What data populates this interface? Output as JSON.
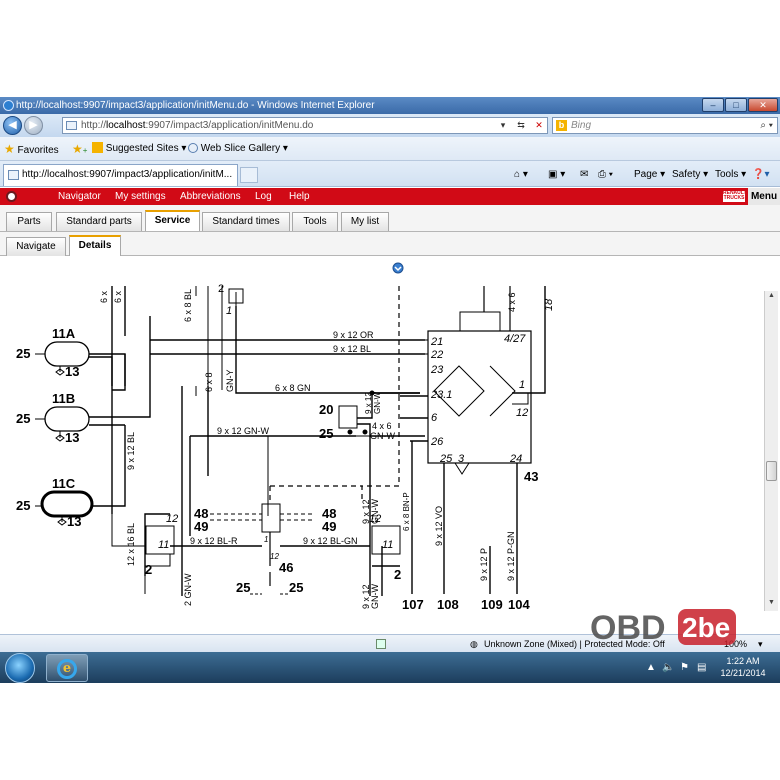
{
  "window": {
    "title": "http://localhost:9907/impact3/application/initMenu.do - Windows Internet Explorer"
  },
  "address": {
    "prefix": "http://",
    "host": "localhost",
    "rest": ":9907/impact3/application/initMenu.do",
    "search_placeholder": "Bing"
  },
  "favorites": {
    "label": "Favorites",
    "suggested": "Suggested Sites ▾",
    "webslice": "Web Slice Gallery ▾"
  },
  "ie_tab": {
    "label": "http://localhost:9907/impact3/application/initM..."
  },
  "commandbar": {
    "page": "Page ▾",
    "safety": "Safety ▾",
    "tools": "Tools ▾"
  },
  "app_menu": {
    "items": [
      "Navigator",
      "My settings",
      "Abbreviations",
      "Log",
      "Help"
    ],
    "menu": "Menu",
    "logo": "RENAULT TRUCKS"
  },
  "app_tabs": [
    "Parts",
    "Standard parts",
    "Service",
    "Standard times",
    "Tools",
    "My list"
  ],
  "active_tab": "Service",
  "sub_tabs": [
    "Navigate",
    "Details"
  ],
  "active_sub_tab": "Details",
  "diagram": {
    "labels": {
      "n11A": "11A",
      "n11B": "11B",
      "n11C": "11C",
      "p25a": "25",
      "p25b": "25",
      "p25c": "25",
      "n13a": "13",
      "n13b": "13",
      "n13c": "13",
      "w6x": "6 x",
      "w6x2": "6 x",
      "w6x8bl": "6 x 8 BL",
      "n2top": "2",
      "n1top": "1",
      "w9x12or": "9 x 12 OR",
      "w9x12bl": "9 x 12 BL",
      "w6x8gny": "6 x 8",
      "w6x8gny2": "GN-Y",
      "w6x8gn": "6 x 8 GN",
      "n20": "20",
      "w9x12gnw": "9 x 12 GN-W",
      "n25mid": "25",
      "w9x12gnwv": "9 x 12",
      "w9x12gnwv2": "GN-W",
      "w4x6": "4 x 6",
      "w4x6b": "GN-W",
      "w9x12blv": "9 x 12 BL",
      "w12x16bl": "12 x 16 BL",
      "n48a": "48",
      "n49a": "49",
      "n48b": "48",
      "n49b": "49",
      "n12a": "12",
      "n11a": "11",
      "n2a": "2",
      "n12b": "12",
      "n11b": "11",
      "n2b": "2",
      "w9x12blr": "9 x 12 BL-R",
      "w9x12blgn": "9 x 12 BL-GN",
      "n46": "46",
      "n1": "1",
      "n12": "12",
      "w2gnw": "2 GN-W",
      "n25l": "25",
      "n25r": "25",
      "w9x12gnw3": "9 x 12",
      "w9x12gnw4": "GN-W",
      "w9x12gnw5": "9 x 12",
      "w9x12gnw6": "GN-W",
      "b21": "21",
      "b22": "22",
      "b23": "23",
      "b231": "23.1",
      "b6": "6",
      "b26": "26",
      "b1": "1",
      "b12": "12",
      "b427": "4/27",
      "b25": "25",
      "b3": "3",
      "b24": "24",
      "b43": "43",
      "b18": "18",
      "b4x6": "4 x 6",
      "w6x8bnp": "6 x 8 BN-P",
      "w9x12vo": "9 x 12 VO",
      "w9x12p": "9 x 12 P",
      "w9x12pgn": "9 x 12 P-GN",
      "t107": "107",
      "t108": "108",
      "t109": "109",
      "t104": "104"
    }
  },
  "status": {
    "zone": "Unknown Zone (Mixed) | Protected Mode: Off",
    "zoom": "100%"
  },
  "taskbar": {
    "time": "1:22 AM",
    "date": "12/21/2014"
  },
  "watermark": {
    "text1": "OBD",
    "text2": "2be"
  },
  "colors": {
    "app_red": "#d10a16",
    "active_tab_accent": "#e8a000",
    "ie_blue": "#3a6aa8"
  }
}
